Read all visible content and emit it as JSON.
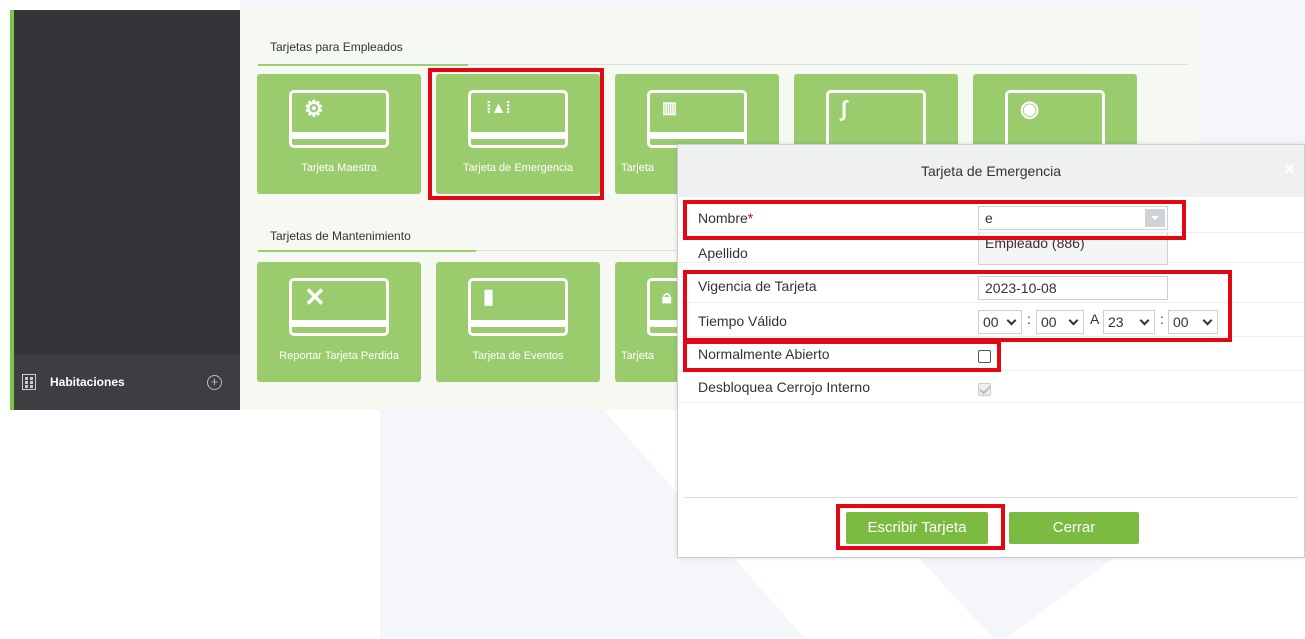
{
  "sidebar": {
    "bottom_item": {
      "icon": "building-icon",
      "label": "Habitaciones",
      "action_icon": "add-circle-icon"
    }
  },
  "employee_section": {
    "title": "Tarjetas para Empleados",
    "tiles": [
      {
        "label": "Tarjeta Maestra",
        "icon": "gear-icon"
      },
      {
        "label": "Tarjeta de Emergencia",
        "icon": "alarm-icon"
      },
      {
        "label": "Tarjeta",
        "icon": "building-icon"
      },
      {
        "label": "",
        "icon": "barrier-icon"
      },
      {
        "label": "",
        "icon": "location-icon"
      }
    ]
  },
  "maintenance_section": {
    "title": "Tarjetas de Mantenimiento",
    "tiles": [
      {
        "label": "Reportar Tarjeta Perdida",
        "icon": "close-icon"
      },
      {
        "label": "Tarjeta de Eventos",
        "icon": "sd-card-icon"
      },
      {
        "label": "Tarjeta",
        "icon": "lock-icon"
      }
    ]
  },
  "dialog": {
    "title": "Tarjeta de Emergencia",
    "close_icon": "×",
    "fields": {
      "nombre_label": "Nombre",
      "required_mark": "*",
      "nombre_value": "e",
      "apellido_label": "Apellido",
      "apellido_value": "Empleado  (886)",
      "vigencia_label": "Vigencia de Tarjeta",
      "vigencia_value": "2023-10-08",
      "tiempo_label": "Tiempo Válido",
      "time_start_hour": "00",
      "time_start_min": "00",
      "time_sep": ":",
      "time_to": "A",
      "time_end_hour": "23",
      "time_end_min": "00",
      "abierto_label": "Normalmente Abierto",
      "abierto_checked": false,
      "cerrojo_label": "Desbloquea Cerrojo Interno",
      "cerrojo_checked": true
    },
    "buttons": {
      "write": "Escribir Tarjeta",
      "close": "Cerrar"
    }
  },
  "colors": {
    "accent_green": "#7cbb42",
    "tile_green": "#9acc6e",
    "highlight_red": "#e30613",
    "sidebar_dark": "#333538"
  }
}
